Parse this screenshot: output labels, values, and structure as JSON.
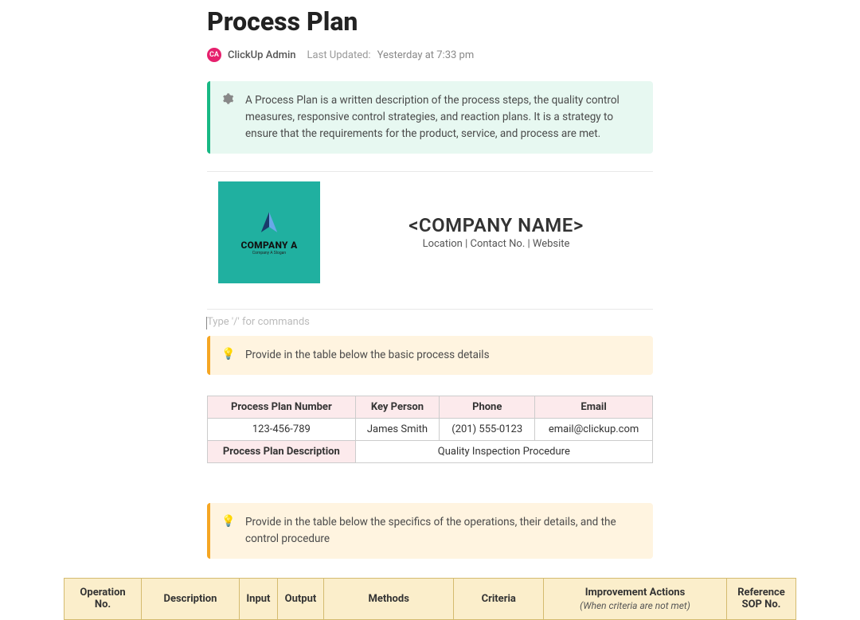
{
  "title": "Process Plan",
  "author": {
    "initials": "CA",
    "name": "ClickUp Admin"
  },
  "updated": {
    "label": "Last Updated:",
    "value": "Yesterday at 7:33 pm"
  },
  "intro_callout": {
    "text": "A Process Plan is a written description of the process steps, the quality control measures, responsive control strategies, and reaction plans. It is a strategy to ensure that the requirements for the product, service, and process are met."
  },
  "company": {
    "logo_name": "COMPANY A",
    "logo_slogan": "Company A Slogan",
    "name": "<COMPANY NAME>",
    "subline": "Location | Contact No. | Website"
  },
  "command_placeholder": "Type '/' for commands",
  "callout_basic": "Provide in the table below the basic process details",
  "info": {
    "headers": {
      "plan_no": "Process Plan Number",
      "key_person": "Key Person",
      "phone": "Phone",
      "email": "Email",
      "desc": "Process Plan Description"
    },
    "values": {
      "plan_no": "123-456-789",
      "key_person": "James Smith",
      "phone": "(201) 555-0123",
      "email": "email@clickup.com",
      "desc": "Quality Inspection Procedure"
    }
  },
  "callout_ops": "Provide in the table below the specifics of the operations, their details, and the control procedure",
  "ops_headers": {
    "op_no": "Operation No.",
    "desc": "Description",
    "input": "Input",
    "output": "Output",
    "methods": "Methods",
    "criteria": "Criteria",
    "improve": "Improvement Actions",
    "improve_sub": "(When criteria are not met)",
    "ref": "Reference SOP No."
  }
}
